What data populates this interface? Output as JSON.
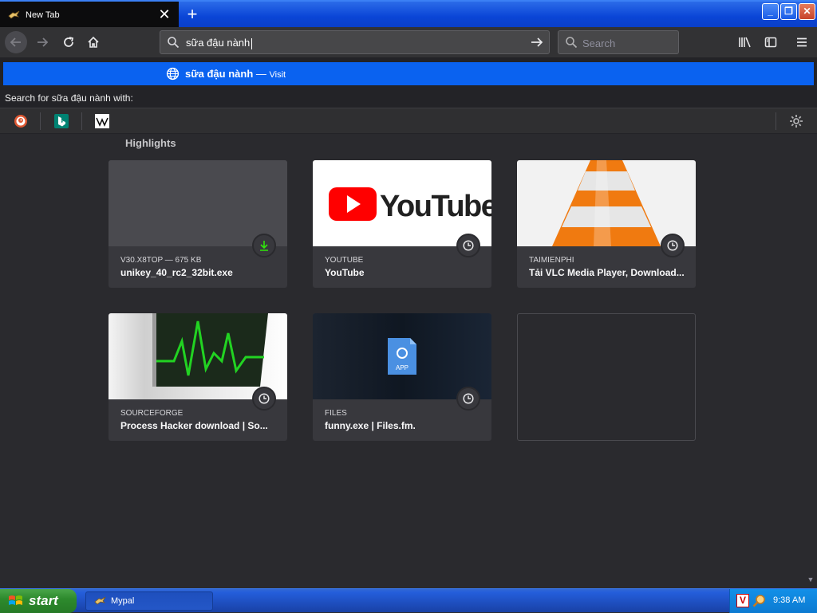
{
  "tab": {
    "title": "New Tab",
    "close_glyph": "✕"
  },
  "tabstrip": {
    "new_tab_glyph": "+"
  },
  "window": {
    "minimize": "_",
    "maximize": "❐",
    "close": "✕"
  },
  "urlbar": {
    "value": "sữa đậu nành"
  },
  "searchbar": {
    "placeholder": "Search"
  },
  "suggestion": {
    "text": "sữa đậu nành",
    "separator": " — ",
    "action": "Visit"
  },
  "search_with": "Search for sữa đậu nành  with:",
  "highlights": {
    "title": "Highlights",
    "cards": [
      {
        "context": "v30.x8top — 675 KB",
        "title": "unikey_40_rc2_32bit.exe",
        "badge": "download-icon"
      },
      {
        "context": "youtube",
        "title": "YouTube",
        "badge": "clock-icon",
        "logo_text": "YouTube"
      },
      {
        "context": "taimienphi",
        "title": "Tải VLC Media Player, Download...",
        "badge": "clock-icon"
      },
      {
        "context": "sourceforge",
        "title": "Process Hacker download | So...",
        "badge": "clock-icon"
      },
      {
        "context": "files",
        "title": "funny.exe | Files.fm.",
        "badge": "clock-icon",
        "file_label": "APP"
      }
    ]
  },
  "taskbar": {
    "start_label": "start",
    "task_label": "Mypal",
    "clock": "9:38 AM",
    "tray_v": "V"
  },
  "colors": {
    "accent": "#0a62f0",
    "background": "#2a2a2e",
    "card": "#38383d",
    "download_green": "#30e60b",
    "youtube_red": "#ff0000",
    "vlc_orange": "#f07a10"
  }
}
